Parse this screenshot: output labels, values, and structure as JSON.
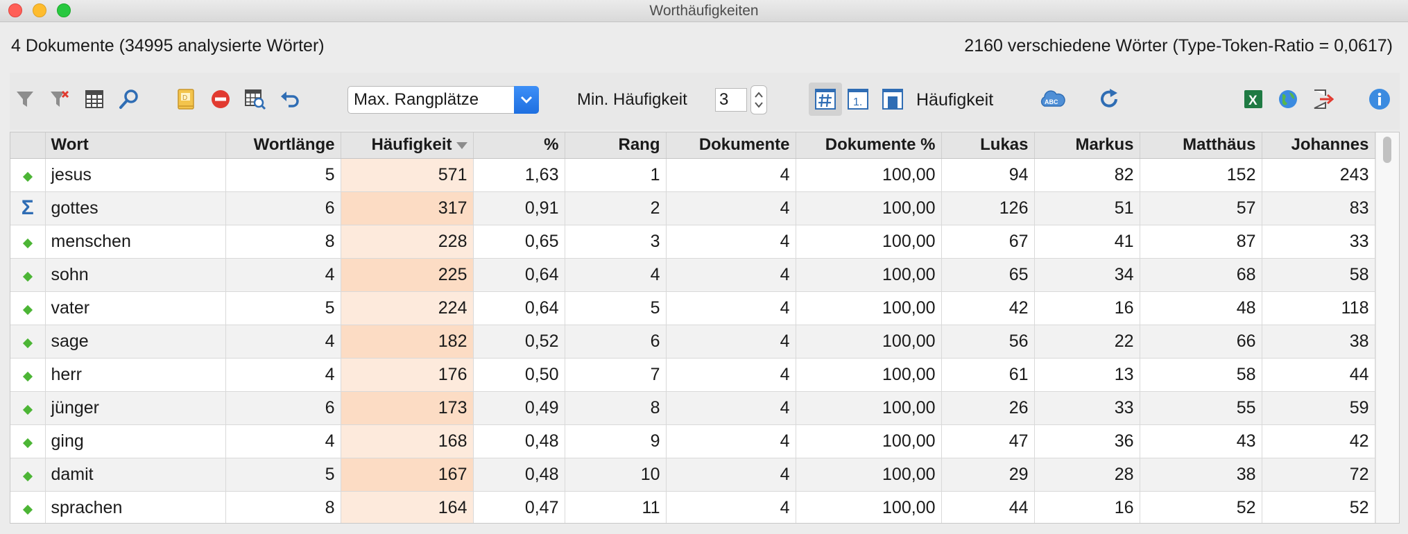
{
  "window": {
    "title": "Worthäufigkeiten"
  },
  "info": {
    "left": "4 Dokumente (34995 analysierte Wörter)",
    "right": "2160 verschiedene Wörter (Type-Token-Ratio = 0,0617)"
  },
  "toolbar": {
    "icons": [
      "filter-icon",
      "clear-filter-icon",
      "columns-icon",
      "search-icon",
      "dictionary-icon",
      "stop-list-icon",
      "table-search-icon",
      "undo-icon",
      "hash-icon",
      "rank-icon",
      "frequency-icon",
      "cloud-icon",
      "refresh-icon",
      "excel-icon",
      "globe-icon",
      "export-icon",
      "info-icon"
    ],
    "dropdown_value": "Max. Rangplätze",
    "min_label": "Min. Häufigkeit",
    "min_value": "3",
    "mode_label": "Häufigkeit"
  },
  "table": {
    "headers": [
      "",
      "Wort",
      "Wortlänge",
      "Häufigkeit",
      "%",
      "Rang",
      "Dokumente",
      "Dokumente %",
      "Lukas",
      "Markus",
      "Matthäus",
      "Johannes"
    ],
    "sorted_column": "Häufigkeit",
    "rows": [
      {
        "marker": "diamond",
        "cells": [
          "jesus",
          "5",
          "571",
          "1,63",
          "1",
          "4",
          "100,00",
          "94",
          "82",
          "152",
          "243"
        ]
      },
      {
        "marker": "sigma",
        "cells": [
          "gottes",
          "6",
          "317",
          "0,91",
          "2",
          "4",
          "100,00",
          "126",
          "51",
          "57",
          "83"
        ]
      },
      {
        "marker": "diamond",
        "cells": [
          "menschen",
          "8",
          "228",
          "0,65",
          "3",
          "4",
          "100,00",
          "67",
          "41",
          "87",
          "33"
        ]
      },
      {
        "marker": "diamond",
        "cells": [
          "sohn",
          "4",
          "225",
          "0,64",
          "4",
          "4",
          "100,00",
          "65",
          "34",
          "68",
          "58"
        ]
      },
      {
        "marker": "diamond",
        "cells": [
          "vater",
          "5",
          "224",
          "0,64",
          "5",
          "4",
          "100,00",
          "42",
          "16",
          "48",
          "118"
        ]
      },
      {
        "marker": "diamond",
        "cells": [
          "sage",
          "4",
          "182",
          "0,52",
          "6",
          "4",
          "100,00",
          "56",
          "22",
          "66",
          "38"
        ]
      },
      {
        "marker": "diamond",
        "cells": [
          "herr",
          "4",
          "176",
          "0,50",
          "7",
          "4",
          "100,00",
          "61",
          "13",
          "58",
          "44"
        ]
      },
      {
        "marker": "diamond",
        "cells": [
          "jünger",
          "6",
          "173",
          "0,49",
          "8",
          "4",
          "100,00",
          "26",
          "33",
          "55",
          "59"
        ]
      },
      {
        "marker": "diamond",
        "cells": [
          "ging",
          "4",
          "168",
          "0,48",
          "9",
          "4",
          "100,00",
          "47",
          "36",
          "43",
          "42"
        ]
      },
      {
        "marker": "diamond",
        "cells": [
          "damit",
          "5",
          "167",
          "0,48",
          "10",
          "4",
          "100,00",
          "29",
          "28",
          "38",
          "72"
        ]
      },
      {
        "marker": "diamond",
        "cells": [
          "sprachen",
          "8",
          "164",
          "0,47",
          "11",
          "4",
          "100,00",
          "44",
          "16",
          "52",
          "52"
        ]
      }
    ]
  },
  "colors": {
    "marker_green": "#4cb535",
    "sigma_blue": "#2f6db4",
    "freq_tint": "#fcdcc4",
    "accent_blue": "#1e6fe0"
  }
}
